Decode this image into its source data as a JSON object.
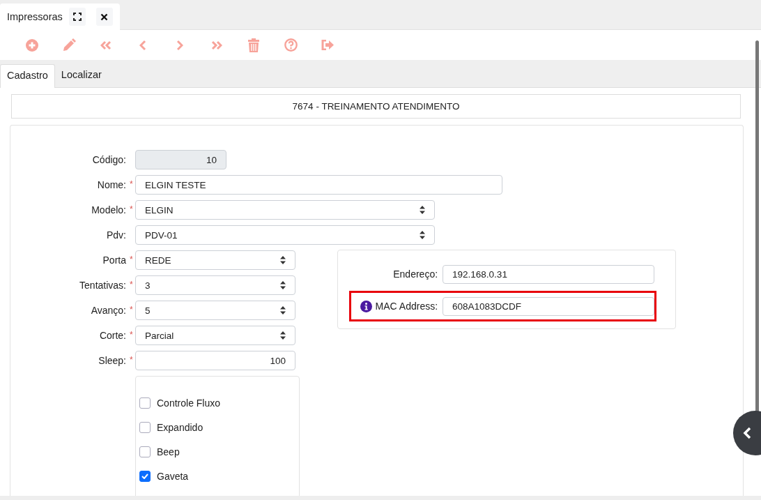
{
  "document_tab": {
    "title": "Impressoras"
  },
  "toolbar": [
    {
      "kind": "add"
    },
    {
      "kind": "edit"
    },
    {
      "kind": "first"
    },
    {
      "kind": "prev"
    },
    {
      "kind": "next"
    },
    {
      "kind": "last"
    },
    {
      "kind": "delete"
    },
    {
      "kind": "help"
    },
    {
      "kind": "exit"
    }
  ],
  "tabs": [
    {
      "label": "Cadastro",
      "selected": true
    },
    {
      "label": "Localizar",
      "selected": false
    }
  ],
  "company": "7674 - TREINAMENTO ATENDIMENTO",
  "required_marker": "*",
  "fields": [
    {
      "label": "Código:",
      "required": false,
      "kind": "readonly",
      "value": "10"
    },
    {
      "label": "Nome:",
      "required": true,
      "kind": "text",
      "value": "ELGIN TESTE"
    },
    {
      "label": "Modelo:",
      "required": true,
      "kind": "select",
      "value": "ELGIN"
    },
    {
      "label": "Pdv:",
      "required": false,
      "kind": "select",
      "value": "PDV-01"
    },
    {
      "label": "Porta",
      "required": true,
      "kind": "select",
      "value": "REDE"
    },
    {
      "label": "Tentativas:",
      "required": true,
      "kind": "select",
      "value": "3"
    },
    {
      "label": "Avanço:",
      "required": true,
      "kind": "select",
      "value": "5"
    },
    {
      "label": "Corte:",
      "required": true,
      "kind": "select",
      "value": "Parcial"
    },
    {
      "label": "Sleep:",
      "required": true,
      "kind": "number",
      "value": "100"
    }
  ],
  "options": [
    {
      "label": "Controle Fluxo",
      "checked": false
    },
    {
      "label": "Expandido",
      "checked": false
    },
    {
      "label": "Beep",
      "checked": false
    },
    {
      "label": "Gaveta",
      "checked": true
    }
  ],
  "network": [
    {
      "label": "Endereço:",
      "value": "192.168.0.31",
      "info": false,
      "highlighted": false
    },
    {
      "label": "MAC Address:",
      "value": "608A1083DCDF",
      "info": true,
      "highlighted": true
    }
  ]
}
